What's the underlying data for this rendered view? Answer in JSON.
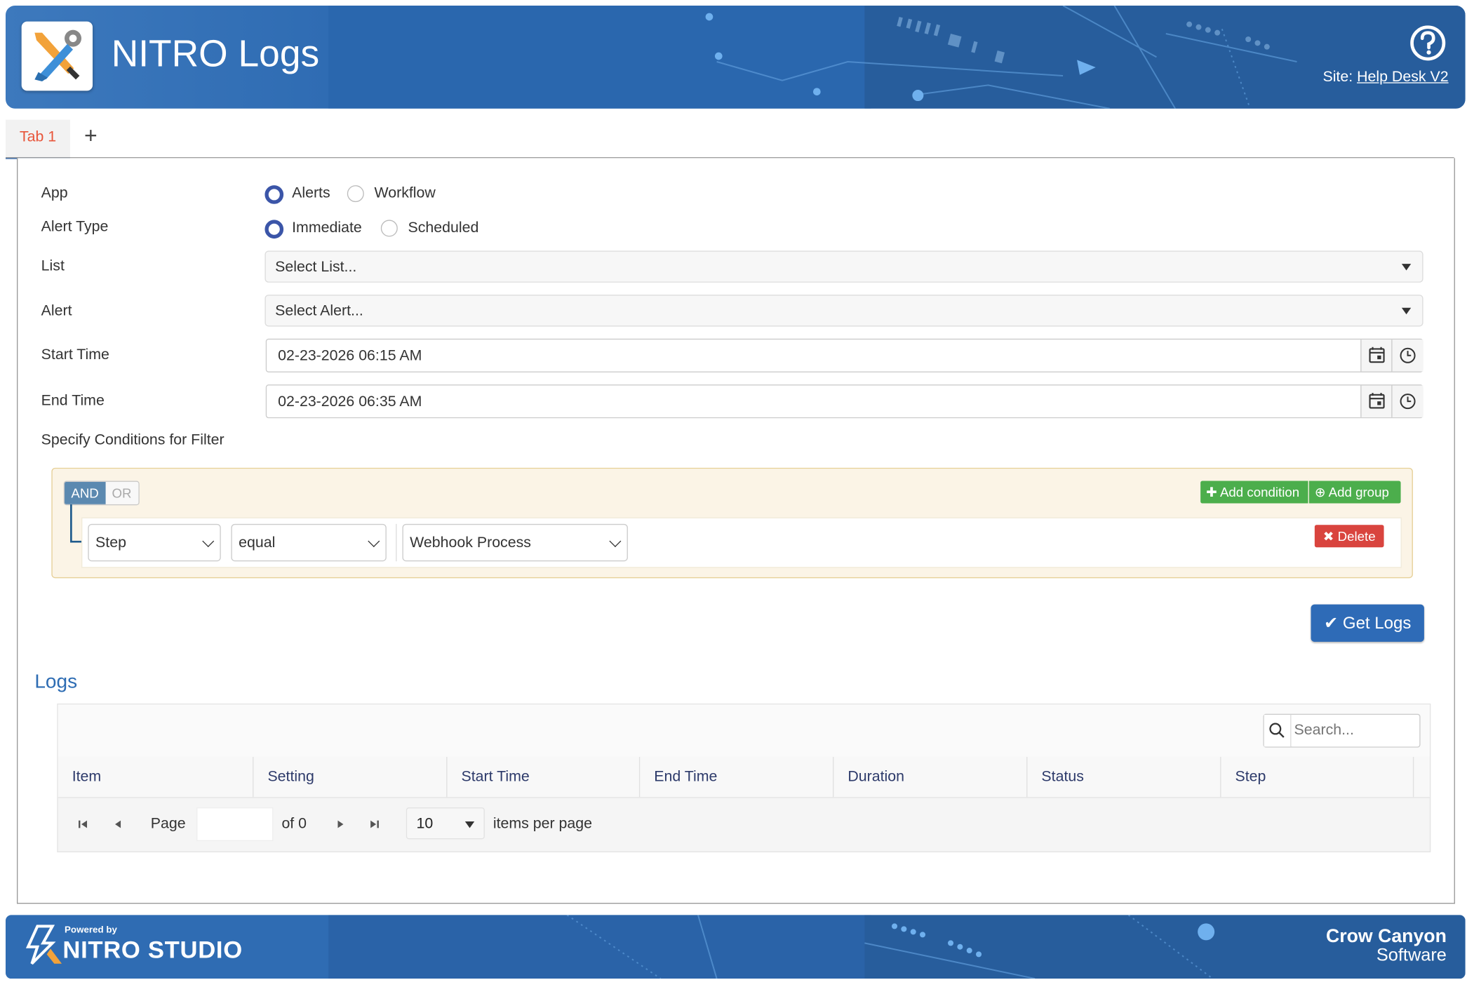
{
  "header": {
    "title": "NITRO Logs",
    "site_label": "Site:",
    "site_name": "Help Desk V2"
  },
  "tabs": [
    {
      "label": "Tab 1"
    }
  ],
  "tab_add": "+",
  "form": {
    "app": {
      "label": "App",
      "options": [
        "Alerts",
        "Workflow"
      ],
      "selected": "Alerts"
    },
    "alert_type": {
      "label": "Alert Type",
      "options": [
        "Immediate",
        "Scheduled"
      ],
      "selected": "Immediate"
    },
    "list": {
      "label": "List",
      "placeholder": "Select List..."
    },
    "alert": {
      "label": "Alert",
      "placeholder": "Select Alert..."
    },
    "start_time": {
      "label": "Start Time",
      "value": "02-23-2026 06:15 AM"
    },
    "end_time": {
      "label": "End Time",
      "value": "02-23-2026 06:35 AM"
    },
    "conditions_label": "Specify Conditions for Filter"
  },
  "query_builder": {
    "and_label": "AND",
    "or_label": "OR",
    "add_condition": "Add condition",
    "add_group": "Add group",
    "rule": {
      "field": "Step",
      "operator": "equal",
      "value": "Webhook Process"
    },
    "delete_label": "Delete"
  },
  "get_logs_label": "Get Logs",
  "logs": {
    "title": "Logs",
    "search_placeholder": "Search...",
    "columns": [
      "Item",
      "Setting",
      "Start Time",
      "End Time",
      "Duration",
      "Status",
      "Step"
    ],
    "pager": {
      "page_label": "Page",
      "of_label": "of 0",
      "page_size": "10",
      "items_per_page": "items per page"
    }
  },
  "footer": {
    "powered_by": "Powered by",
    "studio_name": "NITRO STUDIO",
    "company_line1": "Crow Canyon",
    "company_line2": "Software"
  }
}
